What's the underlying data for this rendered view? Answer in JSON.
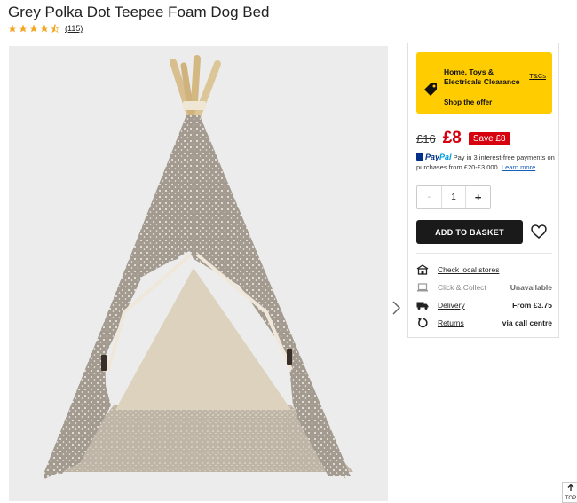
{
  "product": {
    "title": "Grey Polka Dot Teepee Foam Dog Bed",
    "rating_count": "(115)",
    "rating_stars": 4.5
  },
  "promo": {
    "title": "Home, Toys & Electricals Clearance",
    "tc_label": "T&Cs",
    "link_label": "Shop the offer",
    "color": "#ffcc00"
  },
  "price": {
    "old": "£16",
    "new": "£8",
    "save": "Save £8",
    "accent": "#d7000f"
  },
  "paypal": {
    "logo_pay": "Pay",
    "logo_pal": "Pal",
    "text": "Pay in 3 interest-free payments on purchases from £20-£3,000.",
    "link": "Learn more"
  },
  "quantity": {
    "minus": "-",
    "value": "1",
    "plus": "+"
  },
  "basket": {
    "add_label": "ADD TO BASKET"
  },
  "fulfilment": {
    "stores": {
      "label": "Check local stores",
      "icon": "store-icon"
    },
    "collect": {
      "label": "Click & Collect",
      "value": "Unavailable",
      "icon": "laptop-icon"
    },
    "delivery": {
      "label": "Delivery",
      "value": "From £3.75",
      "icon": "truck-icon"
    },
    "returns": {
      "label": "Returns",
      "value": "via call centre",
      "icon": "return-icon"
    }
  },
  "scroll_top": {
    "label": "TOP"
  }
}
